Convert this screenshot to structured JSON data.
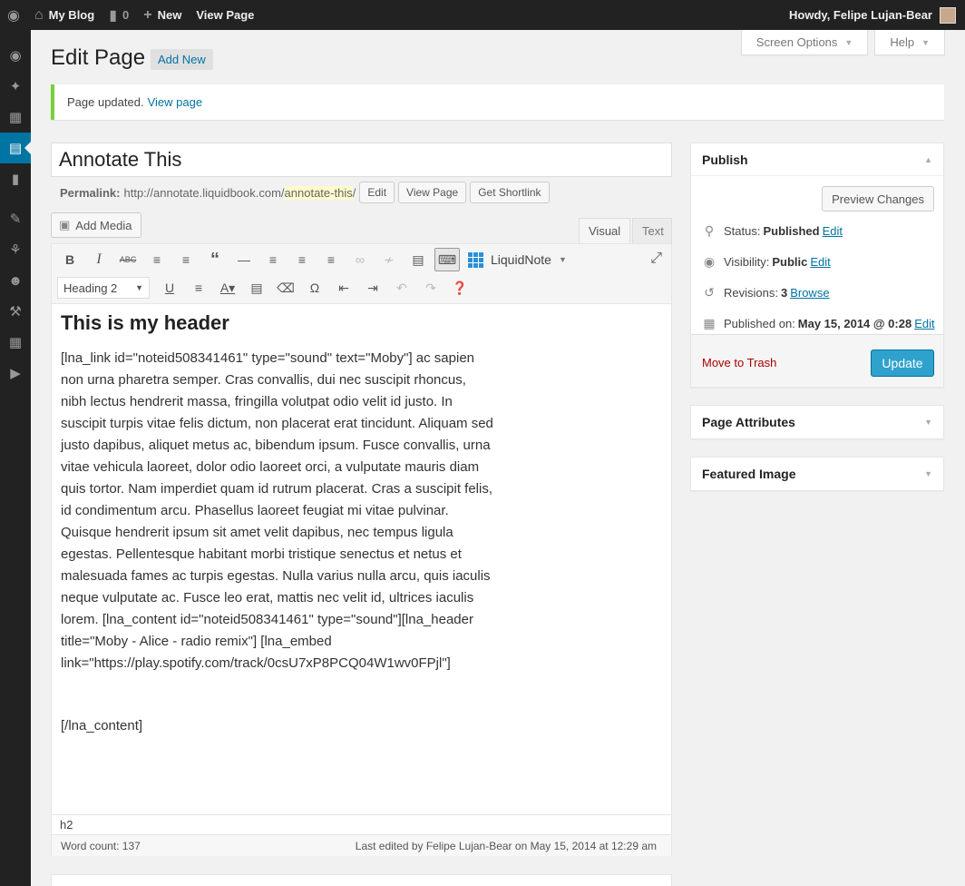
{
  "adminbar": {
    "site_name": "My Blog",
    "comments_count": "0",
    "new_label": "New",
    "view_page_label": "View Page",
    "howdy": "Howdy, Felipe Lujan-Bear"
  },
  "screen_meta": {
    "screen_options": "Screen Options",
    "help": "Help"
  },
  "page": {
    "title": "Edit Page",
    "add_new": "Add New"
  },
  "notice": {
    "text": "Page updated.",
    "link": "View page"
  },
  "post": {
    "title": "Annotate This",
    "permalink_label": "Permalink:",
    "permalink_base": "http://annotate.liquidbook.com/",
    "permalink_slug": "annotate-this",
    "permalink_tail": "/",
    "edit_btn": "Edit",
    "view_page_btn": "View Page",
    "shortlink_btn": "Get Shortlink"
  },
  "editor": {
    "add_media": "Add Media",
    "tab_visual": "Visual",
    "tab_text": "Text",
    "liquidnote": "LiquidNote",
    "format": "Heading 2",
    "heading": "This is my header",
    "paragraph": "[lna_link id=\"noteid508341461\" type=\"sound\" text=\"Moby\"] ac sapien non urna pharetra semper. Cras convallis, dui nec suscipit rhoncus, nibh lectus hendrerit massa, fringilla volutpat odio velit id justo. In suscipit turpis vitae felis dictum, non placerat erat tincidunt. Aliquam sed justo dapibus, aliquet metus ac, bibendum ipsum. Fusce convallis, urna vitae vehicula laoreet, dolor odio laoreet orci, a vulputate mauris diam quis tortor. Nam imperdiet quam id rutrum placerat. Cras a suscipit felis, id condimentum arcu. Phasellus laoreet feugiat mi vitae pulvinar. Quisque hendrerit ipsum sit amet velit dapibus, nec tempus ligula egestas. Pellentesque habitant morbi tristique senectus et netus et malesuada fames ac turpis egestas. Nulla varius nulla arcu, quis iaculis neque vulputate ac. Fusce leo erat, mattis nec velit id, ultrices iaculis lorem. [lna_content id=\"noteid508341461\" type=\"sound\"][lna_header title=\"Moby - Alice - radio remix\"] [lna_embed link=\"https://play.spotify.com/track/0csU7xP8PCQ04W1wv0FPjl\"]",
    "closing": "[/lna_content]",
    "path": "h2",
    "word_count": "Word count: 137",
    "last_edited": "Last edited by Felipe Lujan-Bear on May 15, 2014 at 12:29 am"
  },
  "publish": {
    "title": "Publish",
    "preview": "Preview Changes",
    "status_label": "Status:",
    "status_value": "Published",
    "visibility_label": "Visibility:",
    "visibility_value": "Public",
    "revisions_label": "Revisions:",
    "revisions_value": "3",
    "browse": "Browse",
    "published_label": "Published on:",
    "published_value": "May 15, 2014 @ 0:28",
    "edit": "Edit",
    "trash": "Move to Trash",
    "update": "Update"
  },
  "boxes": {
    "attributes": "Page Attributes",
    "featured": "Featured Image"
  }
}
